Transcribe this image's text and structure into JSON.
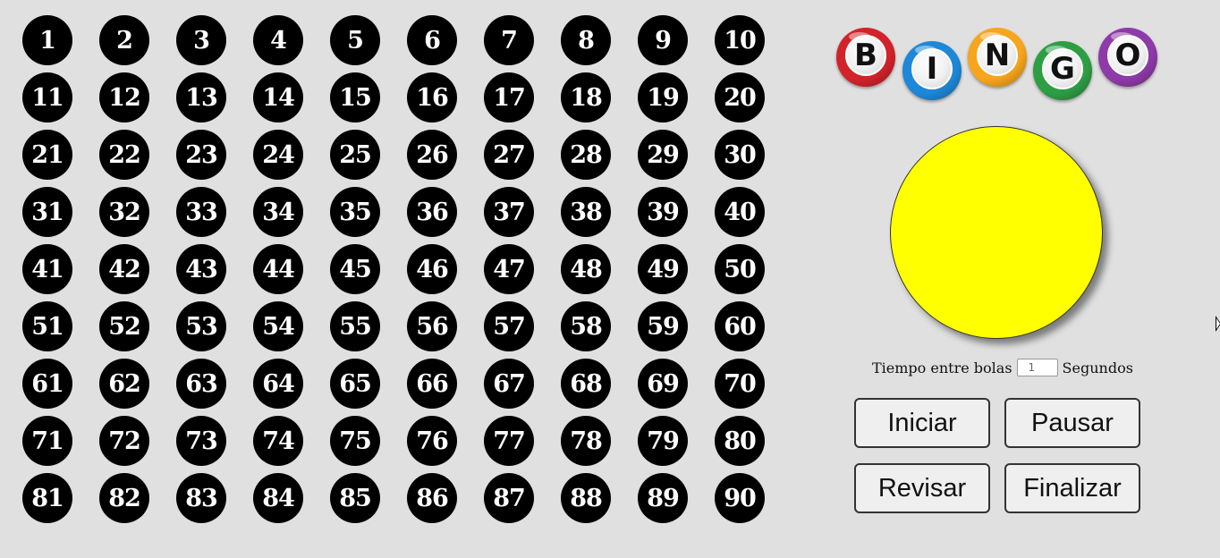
{
  "board": {
    "numbers": [
      "1",
      "2",
      "3",
      "4",
      "5",
      "6",
      "7",
      "8",
      "9",
      "10",
      "11",
      "12",
      "13",
      "14",
      "15",
      "16",
      "17",
      "18",
      "19",
      "20",
      "21",
      "22",
      "23",
      "24",
      "25",
      "26",
      "27",
      "28",
      "29",
      "30",
      "31",
      "32",
      "33",
      "34",
      "35",
      "36",
      "37",
      "38",
      "39",
      "40",
      "41",
      "42",
      "43",
      "44",
      "45",
      "46",
      "47",
      "48",
      "49",
      "50",
      "51",
      "52",
      "53",
      "54",
      "55",
      "56",
      "57",
      "58",
      "59",
      "60",
      "61",
      "62",
      "63",
      "64",
      "65",
      "66",
      "67",
      "68",
      "69",
      "70",
      "71",
      "72",
      "73",
      "74",
      "75",
      "76",
      "77",
      "78",
      "79",
      "80",
      "81",
      "82",
      "83",
      "84",
      "85",
      "86",
      "87",
      "88",
      "89",
      "90"
    ],
    "ball_color": "#000000",
    "text_color": "#ffffff"
  },
  "logo": {
    "letters": [
      {
        "letter": "B",
        "color": "#d2232a"
      },
      {
        "letter": "I",
        "color": "#1e88d8"
      },
      {
        "letter": "N",
        "color": "#f7a51c"
      },
      {
        "letter": "G",
        "color": "#2e9e45"
      },
      {
        "letter": "O",
        "color": "#8e3aa8"
      }
    ]
  },
  "current_ball": {
    "color": "#ffff00",
    "number": ""
  },
  "timer": {
    "label": "Tiempo entre bolas",
    "value": "1",
    "unit": "Segundos"
  },
  "buttons": {
    "start": "Iniciar",
    "pause": "Pausar",
    "review": "Revisar",
    "finish": "Finalizar"
  }
}
